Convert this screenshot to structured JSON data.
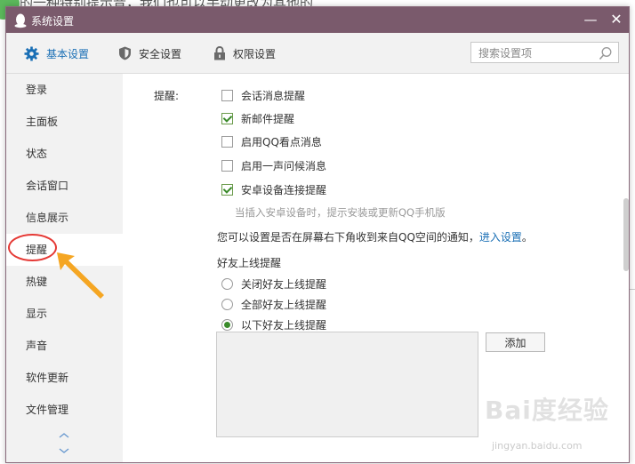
{
  "background": {
    "partial_text": "的一种特别提示音，我们也可以手动更改为其他的"
  },
  "window": {
    "title": "系统设置",
    "minimize": "—",
    "close": "✕"
  },
  "tabs": [
    {
      "label": "基本设置",
      "icon": "gear-icon",
      "active": true
    },
    {
      "label": "安全设置",
      "icon": "shield-icon",
      "active": false
    },
    {
      "label": "权限设置",
      "icon": "lock-icon",
      "active": false
    }
  ],
  "search": {
    "placeholder": "搜索设置项",
    "value": ""
  },
  "sidebar": {
    "items": [
      {
        "label": "登录"
      },
      {
        "label": "主面板"
      },
      {
        "label": "状态"
      },
      {
        "label": "会话窗口"
      },
      {
        "label": "信息展示"
      },
      {
        "label": "提醒",
        "active": true
      },
      {
        "label": "热键"
      },
      {
        "label": "显示"
      },
      {
        "label": "声音"
      },
      {
        "label": "软件更新"
      },
      {
        "label": "文件管理"
      }
    ]
  },
  "content": {
    "remind_label": "提醒:",
    "checkboxes": [
      {
        "label": "会话消息提醒",
        "checked": false
      },
      {
        "label": "新邮件提醒",
        "checked": true
      },
      {
        "label": "启用QQ看点消息",
        "checked": false
      },
      {
        "label": "启用一声问候消息",
        "checked": false
      },
      {
        "label": "安卓设备连接提醒",
        "checked": true
      }
    ],
    "android_hint": "当插入安卓设备时，提示安装或更新QQ手机版",
    "qzone_text": "您可以设置是否在屏幕右下角收到来自QQ空间的通知，",
    "qzone_link": "进入设置",
    "qzone_end": "。",
    "friends_online_label": "好友上线提醒",
    "radios": [
      {
        "label": "关闭好友上线提醒",
        "checked": false
      },
      {
        "label": "全部好友上线提醒",
        "checked": false
      },
      {
        "label": "以下好友上线提醒",
        "checked": true
      }
    ],
    "add_button": "添加"
  },
  "watermark": {
    "brand": "Bai度经验",
    "url": "jingyan.baidu.com"
  },
  "colors": {
    "titlebar": "#7a5a6c",
    "accent": "#1a6fb5",
    "annotation_circle": "#e53935",
    "annotation_arrow": "#f5a623"
  }
}
